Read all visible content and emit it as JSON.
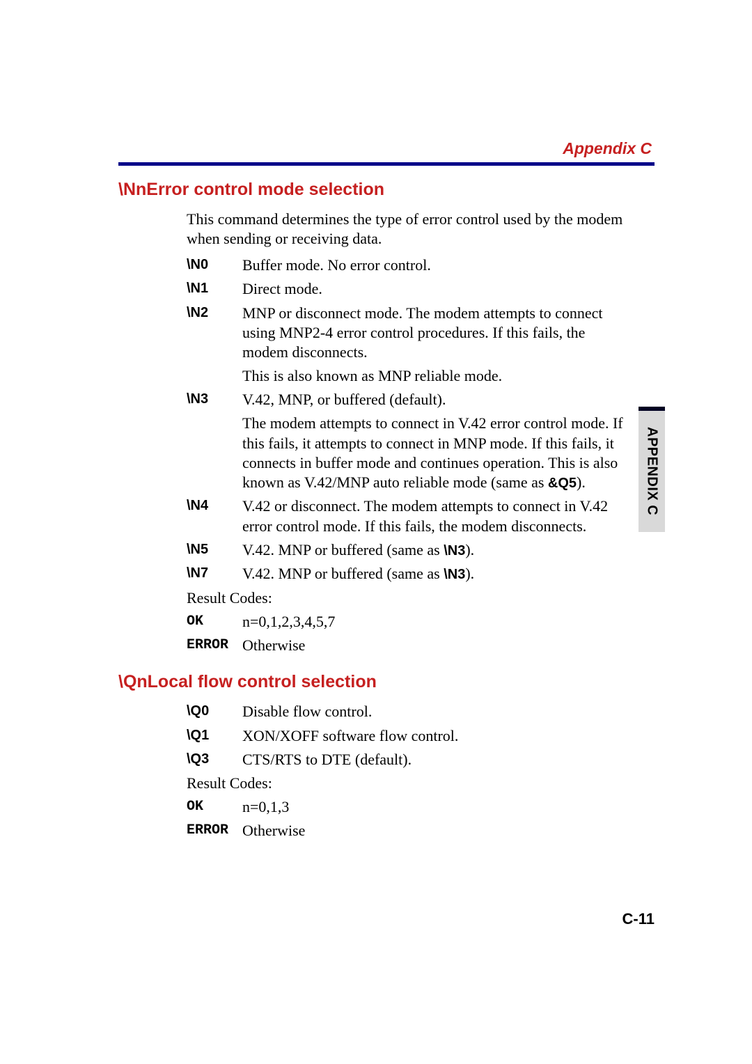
{
  "header": {
    "title": "Appendix C"
  },
  "sideTab": {
    "label": "APPENDIX C"
  },
  "pageNumber": "C-11",
  "section1": {
    "title": "\\NnError control mode selection",
    "intro": "This command determines the type of error control used by the modem when sending or receiving data.",
    "items": {
      "n0": {
        "code": "\\N0",
        "desc": "Buffer mode. No error control."
      },
      "n1": {
        "code": "\\N1",
        "desc": "Direct mode."
      },
      "n2": {
        "code": "\\N2",
        "desc1": "MNP or disconnect mode. The modem attempts to connect using MNP2-4 error control procedures. If this fails, the modem disconnects.",
        "desc2": "This is also known as MNP reliable mode."
      },
      "n3": {
        "code": "\\N3",
        "desc1": "V.42, MNP, or buffered (default).",
        "desc2a": "The modem attempts to connect in V.42 error control mode. If this fails, it attempts to connect in MNP mode. If this fails, it connects in buffer mode and continues operation. This is also known as V.42/MNP auto reliable mode (same as ",
        "desc2b": "&Q5",
        "desc2c": ")."
      },
      "n4": {
        "code": "\\N4",
        "desc": "V.42 or disconnect. The modem attempts to connect in V.42 error control mode. If this fails, the modem disconnects."
      },
      "n5": {
        "code": "\\N5",
        "descA": "V.42. MNP or buffered (same as ",
        "descB": "\\N3",
        "descC": ")."
      },
      "n7": {
        "code": "\\N7",
        "descA": "V.42. MNP or buffered (same as ",
        "descB": "\\N3",
        "descC": ")."
      }
    },
    "resultCodesLabel": "Result Codes:",
    "ok": {
      "code": "OK",
      "desc": "n=0,1,2,3,4,5,7"
    },
    "error": {
      "code": "ERROR",
      "desc": "Otherwise"
    }
  },
  "section2": {
    "title": "\\QnLocal flow control selection",
    "items": {
      "q0": {
        "code": "\\Q0",
        "desc": "Disable flow control."
      },
      "q1": {
        "code": "\\Q1",
        "desc": "XON/XOFF software flow control."
      },
      "q3": {
        "code": "\\Q3",
        "desc": "CTS/RTS to DTE (default)."
      }
    },
    "resultCodesLabel": "Result Codes:",
    "ok": {
      "code": "OK",
      "desc": "n=0,1,3"
    },
    "error": {
      "code": "ERROR",
      "desc": "Otherwise"
    }
  }
}
